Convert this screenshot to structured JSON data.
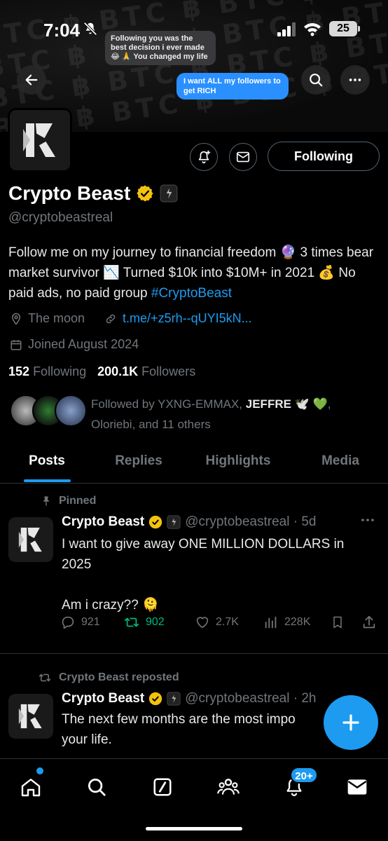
{
  "status_bar": {
    "time": "7:04",
    "battery": "25"
  },
  "banner": {
    "bubble_grey": "Following you was the best decision i ever made 😂 🙏 You changed my life",
    "bubble_blue": "I want ALL my followers to get RICH",
    "pattern": "BTC ฿ BTC ฿ BTC ฿ BTC ฿ BTC ฿"
  },
  "profile": {
    "display_name": "Crypto Beast",
    "handle": "@cryptobeastreal",
    "following_button": "Following",
    "bio": "Follow me on my journey to financial freedom 🔮 3 times bear market survivor 📉 Turned $10k into $10M+ in 2021 💰 No paid ads, no paid group",
    "bio_hashtag": "#CryptoBeast",
    "location": "The moon",
    "link": "t.me/+z5rh--qUYI5kN...",
    "joined": "Joined August 2024",
    "following_count": "152",
    "following_label": "Following",
    "followers_count": "200.1K",
    "followers_label": "Followers",
    "followed_by_prefix": "Followed by YXNG-EMMAX,",
    "followed_by_bold": "JEFFRE",
    "followed_by_emoji": "🕊️ 💚,",
    "followed_by_suffix": "Oloriebi, and 11 others"
  },
  "tabs": [
    "Posts",
    "Replies",
    "Highlights",
    "Media"
  ],
  "pinned_post": {
    "label": "Pinned",
    "name": "Crypto Beast",
    "handle_time": "@cryptobeastreal · 5d",
    "text_line1": "I want to give away ONE MILLION DOLLARS in",
    "text_line2": "2025",
    "text_line3": "Am i crazy?? 🫠",
    "replies": "921",
    "reposts": "902",
    "likes": "2.7K",
    "views": "228K"
  },
  "repost": {
    "label": "Crypto Beast reposted",
    "name": "Crypto Beast",
    "handle_time": "@cryptobeastreal · 2h",
    "text_line1": "The next few months are the most impo",
    "text_line2": "your life."
  },
  "bottom_nav": {
    "notif_badge": "20+"
  },
  "colors": {
    "accent": "#1d9bf0",
    "repost_green": "#00ba7c",
    "gold_badge": "#f4c20d"
  }
}
